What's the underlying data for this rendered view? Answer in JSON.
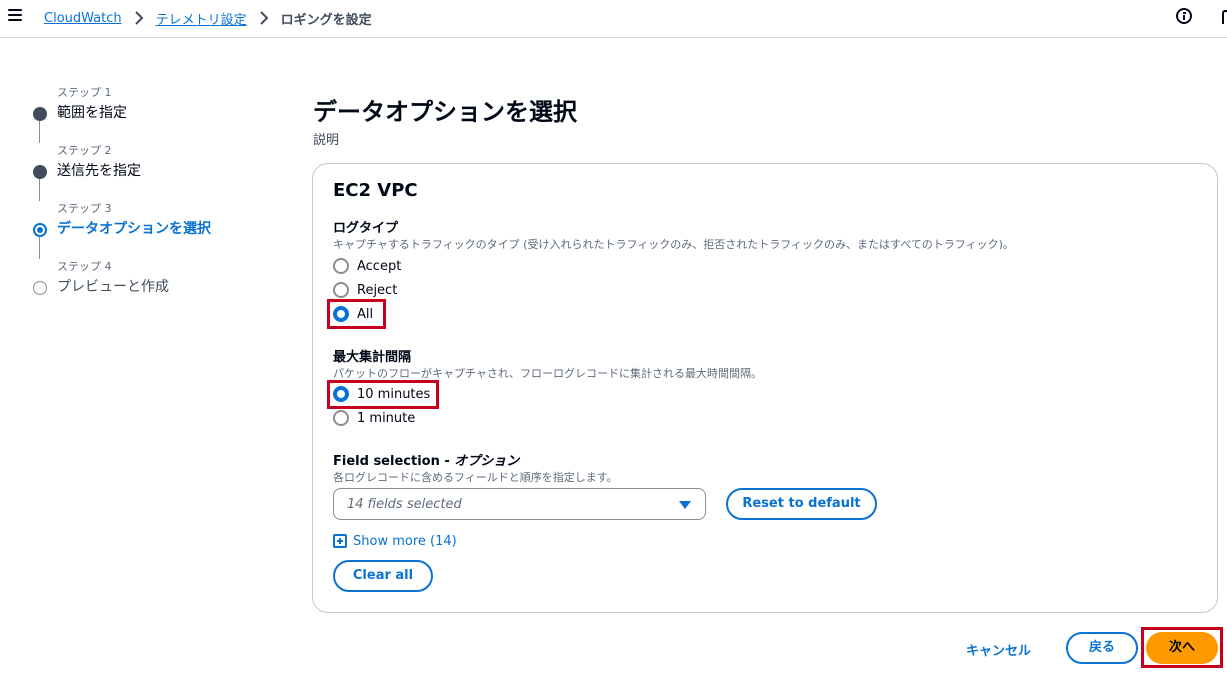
{
  "breadcrumb": {
    "items": [
      "CloudWatch",
      "テレメトリ設定"
    ],
    "current": "ロギングを設定"
  },
  "steps": [
    {
      "label": "ステップ 1",
      "title": "範囲を指定",
      "state": "completed"
    },
    {
      "label": "ステップ 2",
      "title": "送信先を指定",
      "state": "completed"
    },
    {
      "label": "ステップ 3",
      "title": "データオプションを選択",
      "state": "active"
    },
    {
      "label": "ステップ 4",
      "title": "プレビューと作成",
      "state": "pending"
    }
  ],
  "page": {
    "title": "データオプションを選択",
    "description": "説明"
  },
  "container": {
    "title": "EC2 VPC",
    "log_type": {
      "label": "ログタイプ",
      "description": "キャプチャするトラフィックのタイプ (受け入れられたトラフィックのみ、拒否されたトラフィックのみ、またはすべてのトラフィック)。",
      "options": [
        "Accept",
        "Reject",
        "All"
      ],
      "selected": "All"
    },
    "aggregation": {
      "label": "最大集計間隔",
      "description": "パケットのフローがキャプチャされ、フローログレコードに集計される最大時間間隔。",
      "options": [
        "10 minutes",
        "1 minute"
      ],
      "selected": "10 minutes"
    },
    "field_selection": {
      "label": "Field selection - ",
      "label_optional": "オプション",
      "description": "各ログレコードに含めるフィールドと順序を指定します。",
      "select_value": "14 fields selected",
      "reset_label": "Reset to default",
      "show_more_label": "Show more (14)",
      "clear_all_label": "Clear all"
    }
  },
  "footer": {
    "cancel_label": "キャンセル",
    "back_label": "戻る",
    "next_label": "次へ"
  },
  "colors": {
    "accent": "#0972d3",
    "primary_button": "#ff9900",
    "highlight": "#c8001e"
  }
}
